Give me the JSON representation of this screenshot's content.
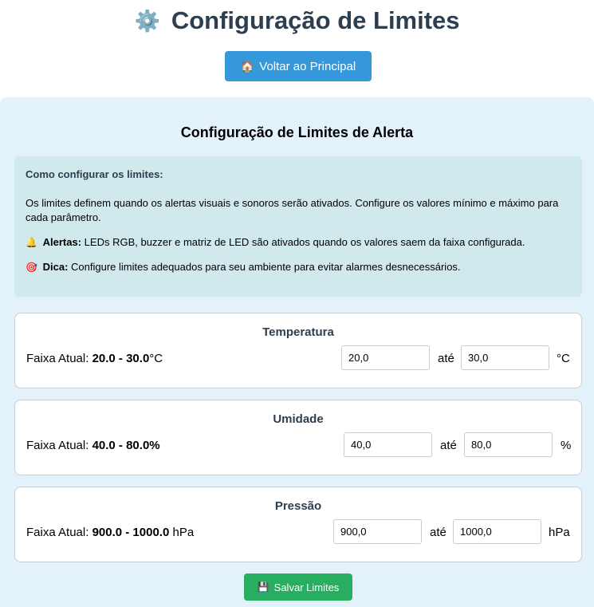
{
  "header": {
    "gear_icon": "⚙️",
    "title": "Configuração de Limites",
    "back_icon": "🏠",
    "back_label": "Voltar ao Principal"
  },
  "panel": {
    "title": "Configuração de Limites de Alerta",
    "info": {
      "heading": "Como configurar os limites:",
      "description": "Os limites definem quando os alertas visuais e sonoros serão ativados. Configure os valores mínimo e máximo para cada parâmetro.",
      "alert_icon": "🔔",
      "alert_label": "Alertas:",
      "alert_text": "LEDs RGB, buzzer e matriz de LED são ativados quando os valores saem da faixa configurada.",
      "tip_icon": "🎯",
      "tip_label": "Dica:",
      "tip_text": "Configure limites adequados para seu ambiente para evitar alarmes desnecessários."
    },
    "range_prefix": "Faixa Atual:",
    "to_label": "até",
    "sensors": [
      {
        "name": "Temperatura",
        "range": "20.0 - 30.0",
        "unit": "°C",
        "min": "20,0",
        "max": "30,0"
      },
      {
        "name": "Umidade",
        "range": "40.0 - 80.0",
        "unit": "%",
        "min": "40,0",
        "max": "80,0"
      },
      {
        "name": "Pressão",
        "range": "900.0 - 1000.0",
        "unit": "hPa",
        "min": "900,0",
        "max": "1000,0"
      }
    ]
  },
  "save": {
    "icon": "💾",
    "label": "Salvar Limites"
  }
}
